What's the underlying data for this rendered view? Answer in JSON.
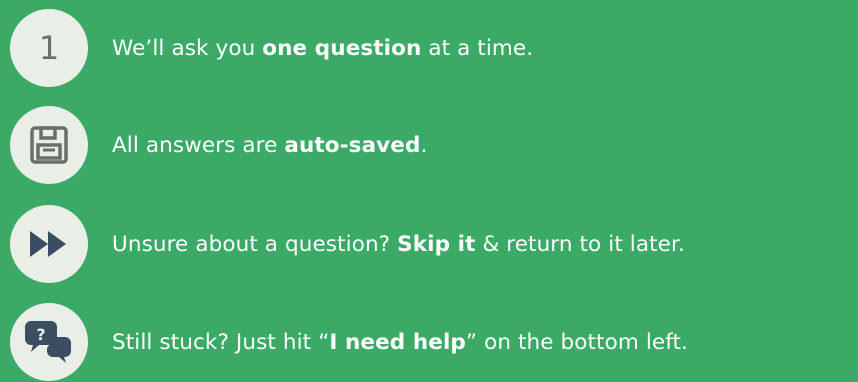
{
  "steps": [
    {
      "badge": "1",
      "badge_icon": "number-one",
      "pre": "We’ll ask you ",
      "bold": "one question",
      "post": " at a time."
    },
    {
      "badge_icon": "floppy-disk-icon",
      "pre": "All answers are ",
      "bold": "auto-saved",
      "post": "."
    },
    {
      "badge_icon": "fast-forward-icon",
      "pre": "Unsure about a question? ",
      "bold": "Skip it",
      "post": " & return to it later."
    },
    {
      "badge_icon": "help-chat-icon",
      "pre": "Still stuck? Just hit “",
      "bold": "I need help",
      "post": "” on the bottom left."
    }
  ],
  "colors": {
    "background": "#3aaa66",
    "badge": "#e9eee7",
    "icon": "#6b6f6c",
    "text": "#ffffff"
  }
}
